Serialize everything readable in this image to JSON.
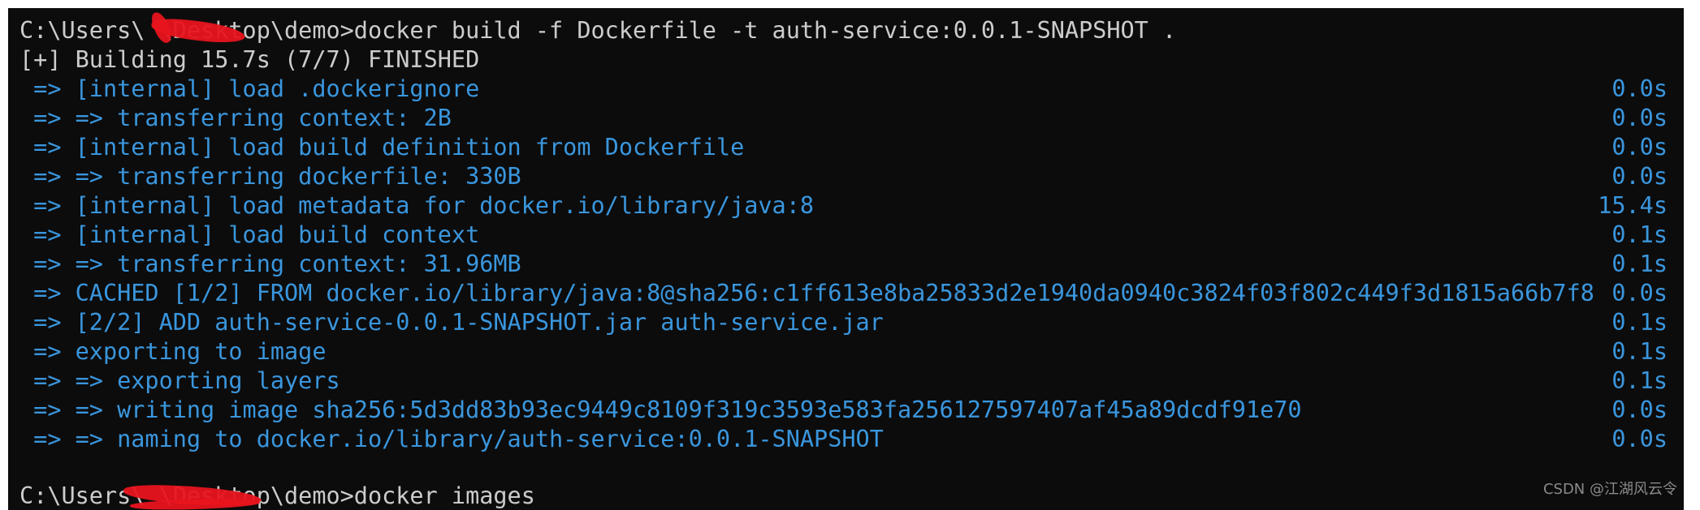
{
  "terminal": {
    "command_line": "C:\\Users\\ \\Desktop\\demo>docker build -f Dockerfile -t auth-service:0.0.1-SNAPSHOT .",
    "status_line": "[+] Building 15.7s (7/7) FINISHED",
    "steps": [
      {
        "text": " => [internal] load .dockerignore",
        "time": "0.0s"
      },
      {
        "text": " => => transferring context: 2B",
        "time": "0.0s"
      },
      {
        "text": " => [internal] load build definition from Dockerfile",
        "time": "0.0s"
      },
      {
        "text": " => => transferring dockerfile: 330B",
        "time": "0.0s"
      },
      {
        "text": " => [internal] load metadata for docker.io/library/java:8",
        "time": "15.4s"
      },
      {
        "text": " => [internal] load build context",
        "time": "0.1s"
      },
      {
        "text": " => => transferring context: 31.96MB",
        "time": "0.1s"
      },
      {
        "text": " => CACHED [1/2] FROM docker.io/library/java:8@sha256:c1ff613e8ba25833d2e1940da0940c3824f03f802c449f3d1815a66b7f8",
        "time": "0.0s"
      },
      {
        "text": " => [2/2] ADD auth-service-0.0.1-SNAPSHOT.jar auth-service.jar",
        "time": "0.1s"
      },
      {
        "text": " => exporting to image",
        "time": "0.1s"
      },
      {
        "text": " => => exporting layers",
        "time": "0.1s"
      },
      {
        "text": " => => writing image sha256:5d3dd83b93ec9449c8109f319c3593e583fa256127597407af45a89dcdf91e70",
        "time": "0.0s"
      },
      {
        "text": " => => naming to docker.io/library/auth-service:0.0.1-SNAPSHOT",
        "time": "0.0s"
      }
    ],
    "second_command_line": "C:\\Users\\ \\Desktop\\demo>docker images"
  },
  "watermark": "CSDN @江湖风云令",
  "colors": {
    "background": "#0c0c0c",
    "prompt_text": "#cccccc",
    "step_text": "#3a96dd",
    "redaction": "#e8141d"
  }
}
